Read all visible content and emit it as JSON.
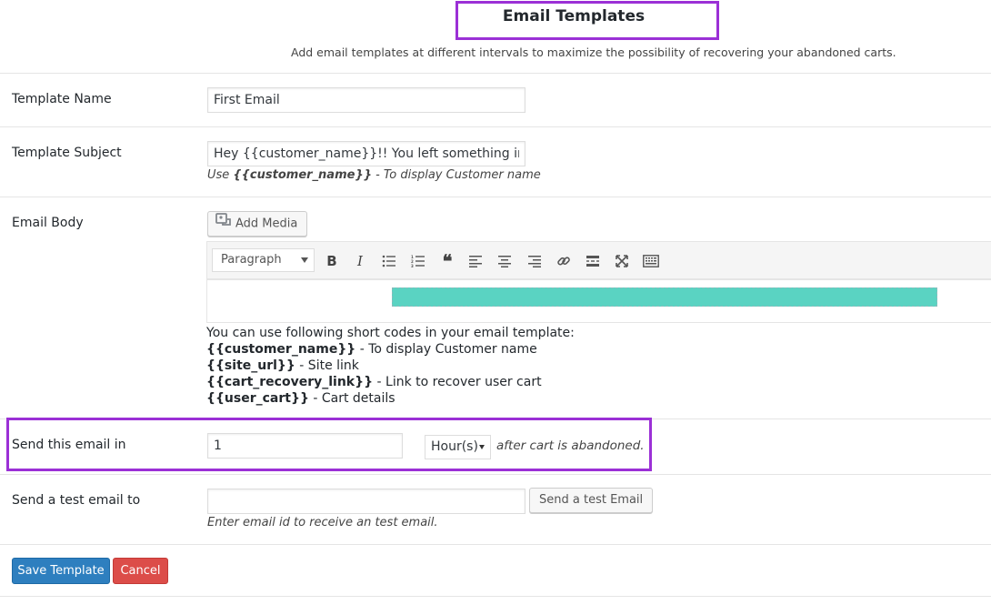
{
  "header": {
    "title": "Email Templates",
    "subtitle": "Add email templates at different intervals to maximize the possibility of recovering your abandoned carts."
  },
  "template_name": {
    "label": "Template Name",
    "value": "First Email"
  },
  "template_subject": {
    "label": "Template Subject",
    "value": "Hey {{customer_name}}!! You left something in your cart",
    "help_prefix": "Use ",
    "help_code": "{{customer_name}}",
    "help_suffix": " - To display Customer name"
  },
  "email_body": {
    "label": "Email Body",
    "add_media_label": "Add Media",
    "format_select": "Paragraph",
    "toolbar_icons": [
      "bold-icon",
      "italic-icon",
      "bullet-list-icon",
      "numbered-list-icon",
      "blockquote-icon",
      "align-left-icon",
      "align-center-icon",
      "align-right-icon",
      "link-icon",
      "read-more-icon",
      "fullscreen-icon",
      "toolbar-toggle-icon"
    ],
    "shortcodes_intro": "You can use following short codes in your email template:",
    "shortcodes": [
      {
        "code": "{{customer_name}}",
        "desc": " - To display Customer name"
      },
      {
        "code": "{{site_url}}",
        "desc": " - Site link"
      },
      {
        "code": "{{cart_recovery_link}}",
        "desc": " - Link to recover user cart"
      },
      {
        "code": "{{user_cart}}",
        "desc": " - Cart details"
      }
    ]
  },
  "send_interval": {
    "label": "Send this email in",
    "value": "1",
    "unit": "Hour(s)",
    "suffix": "after cart is abandoned."
  },
  "test_email": {
    "label": "Send a test email to",
    "value": "",
    "button_label": "Send a test Email",
    "help": "Enter email id to receive an test email."
  },
  "actions": {
    "save_label": "Save Template",
    "cancel_label": "Cancel"
  },
  "colors": {
    "highlight": "#9b30d6",
    "primary": "#2e7fbf",
    "danger": "#dc4d49",
    "teal": "#5ad3c2"
  }
}
